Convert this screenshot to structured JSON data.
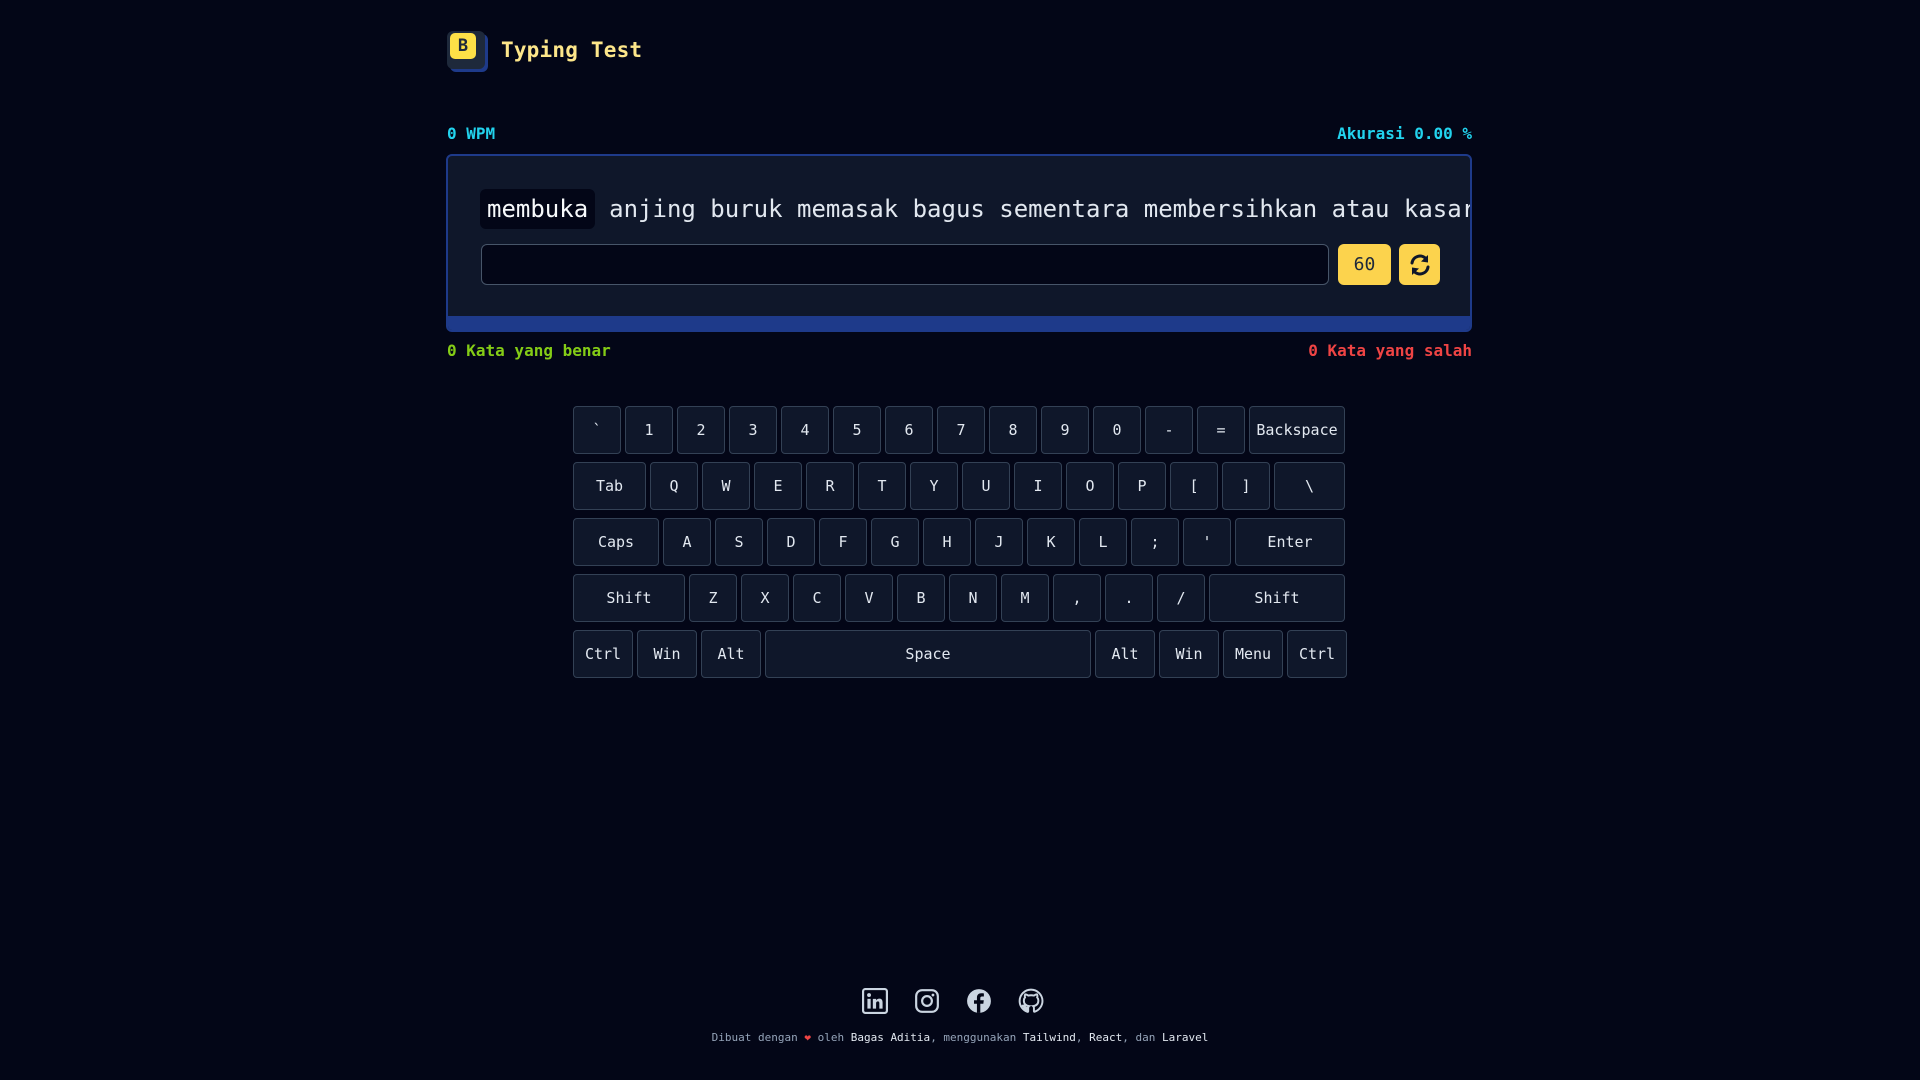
{
  "header": {
    "logo_letter": "B",
    "title": "Typing Test"
  },
  "stats": {
    "wpm": "0 WPM",
    "accuracy": "Akurasi 0.00 %",
    "correct": "0 Kata yang benar",
    "wrong": "0 Kata yang salah"
  },
  "typing": {
    "current_word": "membuka",
    "upcoming_words": "anjing buruk memasak bagus sementara membersihkan atau kasar…",
    "input_value": "",
    "timer": "60"
  },
  "keyboard": {
    "rows": [
      [
        "`",
        "1",
        "2",
        "3",
        "4",
        "5",
        "6",
        "7",
        "8",
        "9",
        "0",
        "-",
        "=",
        "Backspace"
      ],
      [
        "Tab",
        "Q",
        "W",
        "E",
        "R",
        "T",
        "Y",
        "U",
        "I",
        "O",
        "P",
        "[",
        "]",
        "\\"
      ],
      [
        "Caps",
        "A",
        "S",
        "D",
        "F",
        "G",
        "H",
        "J",
        "K",
        "L",
        ";",
        "'",
        "Enter"
      ],
      [
        "Shift",
        "Z",
        "X",
        "C",
        "V",
        "B",
        "N",
        "M",
        ",",
        ".",
        "/",
        "Shift"
      ],
      [
        "Ctrl",
        "Win",
        "Alt",
        "Space",
        "Alt",
        "Win",
        "Menu",
        "Ctrl"
      ]
    ]
  },
  "footer": {
    "socials": [
      "linkedin-icon",
      "instagram-icon",
      "facebook-icon",
      "github-icon"
    ],
    "made_with": "Dibuat dengan",
    "heart": "❤",
    "by": "oleh",
    "author": "Bagas Aditia",
    "using": ", menggunakan",
    "tech1": "Tailwind",
    "sep": ",",
    "tech2": "React",
    "and": ", dan",
    "tech3": "Laravel"
  },
  "colors": {
    "background": "#030617",
    "accent_yellow": "#fcd34d",
    "accent_cyan": "#22d3ee",
    "correct_green": "#84cc16",
    "wrong_red": "#ef4444",
    "card_border": "#1e3a8a"
  }
}
